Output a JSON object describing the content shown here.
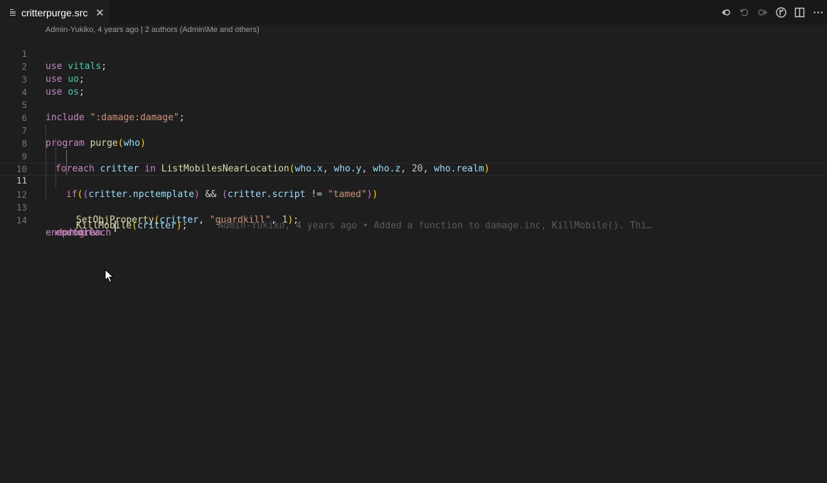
{
  "tab": {
    "title": "critterpurge.src",
    "close_glyph": "✕",
    "icon": "menu-lines-icon"
  },
  "toolbar": {
    "icons": [
      "git-blame-back-icon",
      "revert-changes-icon",
      "git-blame-forward-icon",
      "gitlens-icon",
      "split-editor-icon",
      "more-actions-icon"
    ]
  },
  "blame_header": "Admin-Yukiko, 4 years ago | 2 authors (Admin\\Me and others)",
  "current_line_blame": "Admin-Yukiko, 4 years ago • Added a function to damage.inc, KillMobile(). Thi…",
  "line_numbers": [
    "1",
    "2",
    "3",
    "4",
    "5",
    "6",
    "7",
    "8",
    "9",
    "10",
    "11",
    "12",
    "13",
    "14"
  ],
  "code": {
    "l1": {
      "kw": "use",
      "mod": "vitals",
      "semi": ";"
    },
    "l2": {
      "kw": "use",
      "mod": "uo",
      "semi": ";"
    },
    "l3": {
      "kw": "use",
      "mod": "os",
      "semi": ";"
    },
    "l5": {
      "kw": "include",
      "str": "\":damage:damage\"",
      "semi": ";"
    },
    "l7": {
      "kw": "program",
      "fn": "purge",
      "open": "(",
      "param": "who",
      "close": ")"
    },
    "l8": {
      "kw": "foreach",
      "var": "critter",
      "in": "in",
      "fn": "ListMobilesNearLocation",
      "open": "(",
      "a1": "who",
      "a1p": ".x",
      "c1": ", ",
      "a2": "who",
      "a2p": ".y",
      "c2": ", ",
      "a3": "who",
      "a3p": ".z",
      "c3": ", ",
      "num": "20",
      "c4": ", ",
      "a4": "who",
      "a4p": ".realm",
      "close": ")"
    },
    "l9": {
      "kw": "if",
      "open1": "(",
      "open2": "(",
      "v1": "critter",
      "p1": ".npctemplate",
      "close1": ")",
      "and": " && ",
      "open3": "(",
      "v2": "critter",
      "p2": ".script",
      "neq": " != ",
      "str": "\"tamed\"",
      "close2": ")",
      "close3": ")"
    },
    "l10": {
      "fn": "SetObjProperty",
      "open": "(",
      "v": "critter",
      "c1": ", ",
      "str": "\"guardkill\"",
      "c2": ", ",
      "num": "1",
      "close": ")",
      "semi": ";"
    },
    "l11": {
      "fn_a": "KillMob",
      "fn_b": "ile",
      "open": "(",
      "v": "critter",
      "close": ")",
      "semi": ";"
    },
    "l12": {
      "kw": "endif"
    },
    "l13": {
      "kw": "endforeach"
    },
    "l14": {
      "kw": "endprogram"
    }
  }
}
